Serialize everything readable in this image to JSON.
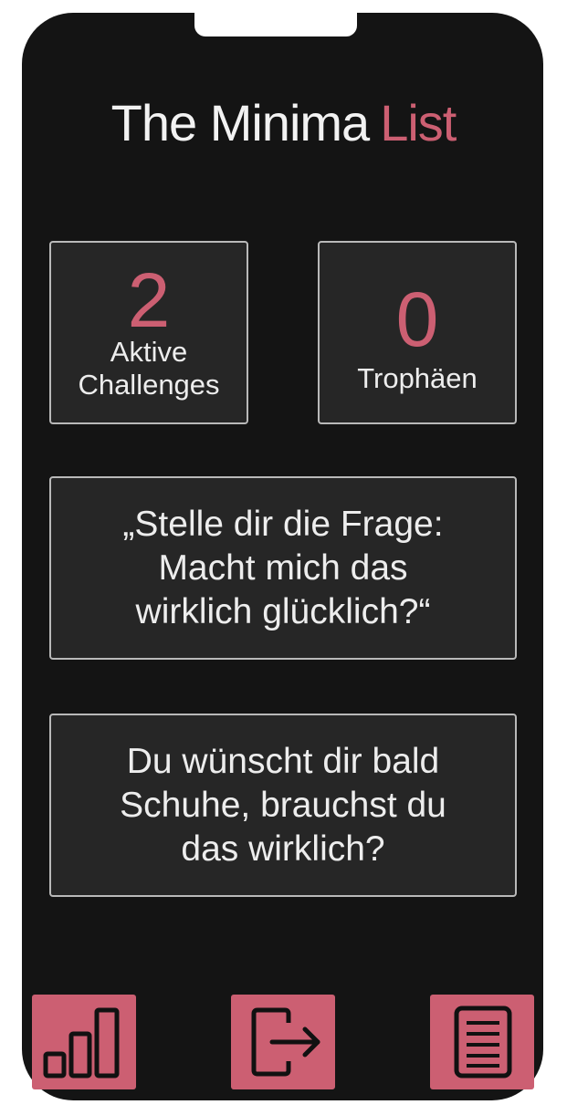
{
  "app": {
    "title_part1": "The Minima",
    "title_part2": "List"
  },
  "stats": [
    {
      "value": "2",
      "label_line1": "Aktive",
      "label_line2": "Challenges"
    },
    {
      "value": "0",
      "label_line1": "Trophäen"
    }
  ],
  "cards": {
    "tip_line1": "„Stelle dir die Frage:",
    "tip_line2": "Macht mich das",
    "tip_line3": "wirklich glücklich?“",
    "question_line1": "Du wünscht dir bald",
    "question_line2": "Schuhe, brauchst du",
    "question_line3": "das wirklich?"
  },
  "nav": [
    {
      "icon": "bar-chart-icon"
    },
    {
      "icon": "logout-icon"
    },
    {
      "icon": "list-document-icon"
    }
  ],
  "colors": {
    "accent": "#cc5f72",
    "background": "#141414",
    "card": "#262626",
    "card_border": "#b9b9b9"
  }
}
